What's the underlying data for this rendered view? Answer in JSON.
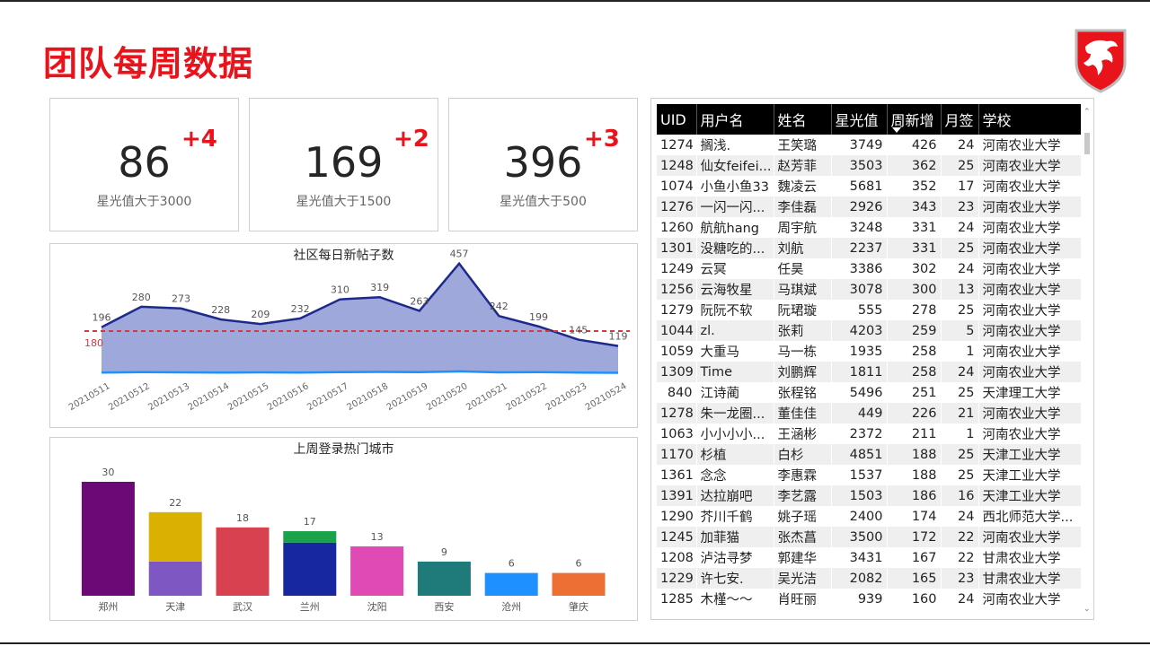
{
  "page": {
    "title": "团队每周数据"
  },
  "kpis": [
    {
      "value": "86",
      "delta": "+4",
      "label": "星光值大于3000"
    },
    {
      "value": "169",
      "delta": "+2",
      "label": "星光值大于1500"
    },
    {
      "value": "396",
      "delta": "+3",
      "label": "星光值大于500"
    }
  ],
  "colors": {
    "accent": "#e8131b",
    "area": "#9aa3d8",
    "line": "#1d2a8c",
    "baseline": "#1e90ff",
    "refline": "#d9363e"
  },
  "chart_data": [
    {
      "type": "area",
      "title": "社区每日新帖子数",
      "categories": [
        "20210511",
        "20210512",
        "20210513",
        "20210514",
        "20210515",
        "20210516",
        "20210517",
        "20210518",
        "20210519",
        "20210520",
        "20210521",
        "20210522",
        "20210523",
        "20210524"
      ],
      "series": [
        {
          "values": [
            196,
            280,
            273,
            228,
            209,
            232,
            310,
            319,
            263,
            457,
            242,
            199,
            145,
            119
          ]
        },
        {
          "values": [
            10,
            12,
            11,
            10,
            11,
            10,
            12,
            13,
            12,
            15,
            11,
            12,
            10,
            9
          ]
        }
      ],
      "reference_line": {
        "value": 180,
        "label": "180"
      },
      "ylim": [
        0,
        500
      ],
      "grid": false
    },
    {
      "type": "bar",
      "title": "上周登录热门城市",
      "categories": [
        "郑州",
        "天津",
        "武汉",
        "兰州",
        "沈阳",
        "西安",
        "沧州",
        "肇庆"
      ],
      "values": [
        30,
        22,
        18,
        17,
        13,
        9,
        6,
        6
      ],
      "stacks": [
        [
          {
            "value": 30,
            "color": "#6b0a77"
          }
        ],
        [
          {
            "value": 9,
            "color": "#7e57c2"
          },
          {
            "value": 13,
            "color": "#dbb100"
          }
        ],
        [
          {
            "value": 18,
            "color": "#d8414f"
          }
        ],
        [
          {
            "value": 14,
            "color": "#1727a0"
          },
          {
            "value": 3,
            "color": "#1aa34a"
          }
        ],
        [
          {
            "value": 13,
            "color": "#e04ab5"
          }
        ],
        [
          {
            "value": 9,
            "color": "#1f7a7a"
          }
        ],
        [
          {
            "value": 6,
            "color": "#1e90ff"
          }
        ],
        [
          {
            "value": 6,
            "color": "#ec6f34"
          }
        ]
      ],
      "ylim": [
        0,
        32
      ]
    }
  ],
  "table": {
    "columns": [
      "UID",
      "用户名",
      "姓名",
      "星光值",
      "周新增",
      "月签",
      "学校"
    ],
    "sorted_column": "周新增",
    "rows": [
      [
        "1274",
        "搁浅.",
        "王笑璐",
        "3749",
        "426",
        "24",
        "河南农业大学"
      ],
      [
        "1248",
        "仙女feifei...",
        "赵芳菲",
        "3503",
        "362",
        "25",
        "河南农业大学"
      ],
      [
        "1074",
        "小鱼小鱼33",
        "魏凌云",
        "5681",
        "352",
        "17",
        "河南农业大学"
      ],
      [
        "1276",
        "一闪一闪...",
        "李佳磊",
        "2926",
        "343",
        "23",
        "河南农业大学"
      ],
      [
        "1260",
        "航航hang",
        "周宇航",
        "3248",
        "331",
        "24",
        "河南农业大学"
      ],
      [
        "1301",
        "没糖吃的...",
        "刘航",
        "2237",
        "331",
        "25",
        "河南农业大学"
      ],
      [
        "1249",
        "云冥",
        "任昊",
        "3386",
        "302",
        "24",
        "河南农业大学"
      ],
      [
        "1256",
        "云海牧星",
        "马琪斌",
        "3078",
        "300",
        "13",
        "河南农业大学"
      ],
      [
        "1279",
        "阮阮不软",
        "阮珺璇",
        "555",
        "278",
        "25",
        "河南农业大学"
      ],
      [
        "1044",
        "zl.",
        "张莉",
        "4203",
        "259",
        "5",
        "河南农业大学"
      ],
      [
        "1059",
        "大重马",
        "马一栋",
        "1935",
        "258",
        "1",
        "河南农业大学"
      ],
      [
        "1309",
        "Time",
        "刘鹏辉",
        "1811",
        "258",
        "24",
        "河南农业大学"
      ],
      [
        "840",
        "江诗蔺",
        "张程铭",
        "5496",
        "251",
        "25",
        "天津理工大学"
      ],
      [
        "1278",
        "朱一龙圈...",
        "董佳佳",
        "449",
        "226",
        "21",
        "河南农业大学"
      ],
      [
        "1063",
        "小小小小...",
        "王涵彬",
        "2372",
        "211",
        "1",
        "河南农业大学"
      ],
      [
        "1170",
        "杉植",
        "白杉",
        "4851",
        "188",
        "25",
        "天津工业大学"
      ],
      [
        "1361",
        "念念",
        "李惠霖",
        "1537",
        "188",
        "25",
        "天津工业大学"
      ],
      [
        "1391",
        "达拉崩吧",
        "李艺露",
        "1503",
        "186",
        "16",
        "天津工业大学"
      ],
      [
        "1290",
        "芥川千鹤",
        "姚子瑶",
        "2400",
        "174",
        "24",
        "西北师范大学..."
      ],
      [
        "1245",
        "加菲猫",
        "张杰菖",
        "3500",
        "172",
        "22",
        "河南农业大学"
      ],
      [
        "1208",
        "泸沽寻梦",
        "郭建华",
        "3431",
        "167",
        "22",
        "甘肃农业大学"
      ],
      [
        "1229",
        "许七安.",
        "吴光洁",
        "2082",
        "165",
        "23",
        "甘肃农业大学"
      ],
      [
        "1285",
        "木槿～～",
        "肖旺丽",
        "939",
        "160",
        "24",
        "河南农业大学"
      ]
    ]
  }
}
